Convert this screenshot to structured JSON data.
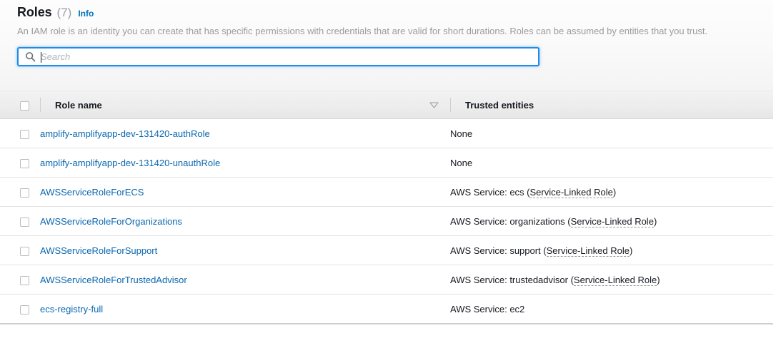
{
  "header": {
    "title": "Roles",
    "count": "(7)",
    "info_label": "Info",
    "description": "An IAM role is an identity you can create that has specific permissions with credentials that are valid for short durations. Roles can be assumed by entities that you trust."
  },
  "search": {
    "placeholder": "Search",
    "value": "",
    "icon": "search-icon"
  },
  "table": {
    "columns": [
      {
        "key": "select",
        "label": ""
      },
      {
        "key": "name",
        "label": "Role name",
        "sort_icon": "sort-descending-icon"
      },
      {
        "key": "trusted",
        "label": "Trusted entities"
      }
    ],
    "rows": [
      {
        "selected": false,
        "name": "amplify-amplifyapp-dev-131420-authRole",
        "trusted_prefix": "None",
        "trusted_suffix": "",
        "service_linked": ""
      },
      {
        "selected": false,
        "name": "amplify-amplifyapp-dev-131420-unauthRole",
        "trusted_prefix": "None",
        "trusted_suffix": "",
        "service_linked": ""
      },
      {
        "selected": false,
        "name": "AWSServiceRoleForECS",
        "trusted_prefix": "AWS Service: ecs (",
        "service_linked": "Service-Linked Role",
        "trusted_suffix": ")"
      },
      {
        "selected": false,
        "name": "AWSServiceRoleForOrganizations",
        "trusted_prefix": "AWS Service: organizations (",
        "service_linked": "Service-Linked Role",
        "trusted_suffix": ")"
      },
      {
        "selected": false,
        "name": "AWSServiceRoleForSupport",
        "trusted_prefix": "AWS Service: support (",
        "service_linked": "Service-Linked Role",
        "trusted_suffix": ")"
      },
      {
        "selected": false,
        "name": "AWSServiceRoleForTrustedAdvisor",
        "trusted_prefix": "AWS Service: trustedadvisor (",
        "service_linked": "Service-Linked Role",
        "trusted_suffix": ")"
      },
      {
        "selected": false,
        "name": "ecs-registry-full",
        "trusted_prefix": "AWS Service: ec2",
        "service_linked": "",
        "trusted_suffix": ""
      }
    ]
  },
  "colors": {
    "link": "#0a67b0",
    "info_link": "#0073bb",
    "focus_border": "#1f8ceb",
    "text": "#16191f",
    "muted": "#9b9b9b"
  }
}
